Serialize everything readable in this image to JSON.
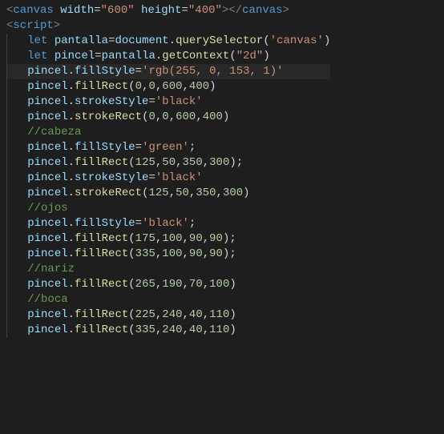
{
  "code": {
    "lines": [
      {
        "indent": 0,
        "type": "html",
        "tokens": [
          {
            "t": "tag-bracket",
            "v": "<"
          },
          {
            "t": "tag-name",
            "v": "canvas"
          },
          {
            "t": "pad",
            "v": " "
          },
          {
            "t": "attr-name",
            "v": "width"
          },
          {
            "t": "attr-equals",
            "v": "="
          },
          {
            "t": "attr-value",
            "v": "\"600\""
          },
          {
            "t": "pad",
            "v": " "
          },
          {
            "t": "attr-name",
            "v": "height"
          },
          {
            "t": "attr-equals",
            "v": "="
          },
          {
            "t": "attr-value",
            "v": "\"400\""
          },
          {
            "t": "tag-bracket",
            "v": "></"
          },
          {
            "t": "tag-name",
            "v": "canvas"
          },
          {
            "t": "tag-bracket",
            "v": ">"
          }
        ]
      },
      {
        "indent": 0,
        "type": "html",
        "tokens": [
          {
            "t": "tag-bracket",
            "v": "<"
          },
          {
            "t": "tag-name",
            "v": "script"
          },
          {
            "t": "tag-bracket",
            "v": ">"
          }
        ]
      },
      {
        "indent": 1,
        "type": "js",
        "tokens": [
          {
            "t": "keyword",
            "v": "let"
          },
          {
            "t": "pad",
            "v": " "
          },
          {
            "t": "variable",
            "v": "pantalla"
          },
          {
            "t": "operator",
            "v": "="
          },
          {
            "t": "identifier",
            "v": "document"
          },
          {
            "t": "punct",
            "v": "."
          },
          {
            "t": "method",
            "v": "querySelector"
          },
          {
            "t": "paren",
            "v": "("
          },
          {
            "t": "string",
            "v": "'canvas'"
          },
          {
            "t": "paren",
            "v": ")"
          }
        ]
      },
      {
        "indent": 1,
        "type": "js",
        "tokens": [
          {
            "t": "keyword",
            "v": "let"
          },
          {
            "t": "pad",
            "v": " "
          },
          {
            "t": "variable",
            "v": "pincel"
          },
          {
            "t": "operator",
            "v": "="
          },
          {
            "t": "identifier",
            "v": "pantalla"
          },
          {
            "t": "punct",
            "v": "."
          },
          {
            "t": "method",
            "v": "getContext"
          },
          {
            "t": "paren",
            "v": "("
          },
          {
            "t": "string",
            "v": "\"2d\""
          },
          {
            "t": "paren",
            "v": ")"
          }
        ]
      },
      {
        "indent": 1,
        "type": "js",
        "highlighted": true,
        "tokens": [
          {
            "t": "identifier",
            "v": "pincel"
          },
          {
            "t": "punct",
            "v": "."
          },
          {
            "t": "property",
            "v": "fillStyle"
          },
          {
            "t": "operator",
            "v": "="
          },
          {
            "t": "string",
            "v": "'rgb(255, 0, 153, 1)'"
          }
        ]
      },
      {
        "indent": 1,
        "type": "js",
        "tokens": [
          {
            "t": "identifier",
            "v": "pincel"
          },
          {
            "t": "punct",
            "v": "."
          },
          {
            "t": "method",
            "v": "fillRect"
          },
          {
            "t": "paren",
            "v": "("
          },
          {
            "t": "number",
            "v": "0"
          },
          {
            "t": "punct",
            "v": ","
          },
          {
            "t": "number",
            "v": "0"
          },
          {
            "t": "punct",
            "v": ","
          },
          {
            "t": "number",
            "v": "600"
          },
          {
            "t": "punct",
            "v": ","
          },
          {
            "t": "number",
            "v": "400"
          },
          {
            "t": "paren",
            "v": ")"
          }
        ]
      },
      {
        "indent": 1,
        "type": "js",
        "tokens": [
          {
            "t": "identifier",
            "v": "pincel"
          },
          {
            "t": "punct",
            "v": "."
          },
          {
            "t": "property",
            "v": "strokeStyle"
          },
          {
            "t": "operator",
            "v": "="
          },
          {
            "t": "string",
            "v": "'black'"
          }
        ]
      },
      {
        "indent": 1,
        "type": "js",
        "tokens": [
          {
            "t": "identifier",
            "v": "pincel"
          },
          {
            "t": "punct",
            "v": "."
          },
          {
            "t": "method",
            "v": "strokeRect"
          },
          {
            "t": "paren",
            "v": "("
          },
          {
            "t": "number",
            "v": "0"
          },
          {
            "t": "punct",
            "v": ","
          },
          {
            "t": "number",
            "v": "0"
          },
          {
            "t": "punct",
            "v": ","
          },
          {
            "t": "number",
            "v": "600"
          },
          {
            "t": "punct",
            "v": ","
          },
          {
            "t": "number",
            "v": "400"
          },
          {
            "t": "paren",
            "v": ")"
          }
        ]
      },
      {
        "indent": 1,
        "type": "js",
        "tokens": [
          {
            "t": "comment",
            "v": "//cabeza"
          }
        ]
      },
      {
        "indent": 1,
        "type": "js",
        "tokens": [
          {
            "t": "identifier",
            "v": "pincel"
          },
          {
            "t": "punct",
            "v": "."
          },
          {
            "t": "property",
            "v": "fillStyle"
          },
          {
            "t": "operator",
            "v": "="
          },
          {
            "t": "string",
            "v": "'green'"
          },
          {
            "t": "punct",
            "v": ";"
          }
        ]
      },
      {
        "indent": 1,
        "type": "js",
        "tokens": [
          {
            "t": "identifier",
            "v": "pincel"
          },
          {
            "t": "punct",
            "v": "."
          },
          {
            "t": "method",
            "v": "fillRect"
          },
          {
            "t": "paren",
            "v": "("
          },
          {
            "t": "number",
            "v": "125"
          },
          {
            "t": "punct",
            "v": ","
          },
          {
            "t": "number",
            "v": "50"
          },
          {
            "t": "punct",
            "v": ","
          },
          {
            "t": "number",
            "v": "350"
          },
          {
            "t": "punct",
            "v": ","
          },
          {
            "t": "number",
            "v": "300"
          },
          {
            "t": "paren",
            "v": ")"
          },
          {
            "t": "punct",
            "v": ";"
          }
        ]
      },
      {
        "indent": 1,
        "type": "js",
        "tokens": [
          {
            "t": "identifier",
            "v": "pincel"
          },
          {
            "t": "punct",
            "v": "."
          },
          {
            "t": "property",
            "v": "strokeStyle"
          },
          {
            "t": "operator",
            "v": "="
          },
          {
            "t": "string",
            "v": "'black'"
          }
        ]
      },
      {
        "indent": 1,
        "type": "js",
        "tokens": [
          {
            "t": "identifier",
            "v": "pincel"
          },
          {
            "t": "punct",
            "v": "."
          },
          {
            "t": "method",
            "v": "strokeRect"
          },
          {
            "t": "paren",
            "v": "("
          },
          {
            "t": "number",
            "v": "125"
          },
          {
            "t": "punct",
            "v": ","
          },
          {
            "t": "number",
            "v": "50"
          },
          {
            "t": "punct",
            "v": ","
          },
          {
            "t": "number",
            "v": "350"
          },
          {
            "t": "punct",
            "v": ","
          },
          {
            "t": "number",
            "v": "300"
          },
          {
            "t": "paren",
            "v": ")"
          }
        ]
      },
      {
        "indent": 1,
        "type": "js",
        "tokens": [
          {
            "t": "comment",
            "v": "//ojos"
          }
        ]
      },
      {
        "indent": 1,
        "type": "js",
        "tokens": [
          {
            "t": "identifier",
            "v": "pincel"
          },
          {
            "t": "punct",
            "v": "."
          },
          {
            "t": "property",
            "v": "fillStyle"
          },
          {
            "t": "operator",
            "v": "="
          },
          {
            "t": "string",
            "v": "'black'"
          },
          {
            "t": "punct",
            "v": ";"
          }
        ]
      },
      {
        "indent": 1,
        "type": "js",
        "tokens": [
          {
            "t": "identifier",
            "v": "pincel"
          },
          {
            "t": "punct",
            "v": "."
          },
          {
            "t": "method",
            "v": "fillRect"
          },
          {
            "t": "paren",
            "v": "("
          },
          {
            "t": "number",
            "v": "175"
          },
          {
            "t": "punct",
            "v": ","
          },
          {
            "t": "number",
            "v": "100"
          },
          {
            "t": "punct",
            "v": ","
          },
          {
            "t": "number",
            "v": "90"
          },
          {
            "t": "punct",
            "v": ","
          },
          {
            "t": "number",
            "v": "90"
          },
          {
            "t": "paren",
            "v": ")"
          },
          {
            "t": "punct",
            "v": ";"
          }
        ]
      },
      {
        "indent": 1,
        "type": "js",
        "tokens": [
          {
            "t": "identifier",
            "v": "pincel"
          },
          {
            "t": "punct",
            "v": "."
          },
          {
            "t": "method",
            "v": "fillRect"
          },
          {
            "t": "paren",
            "v": "("
          },
          {
            "t": "number",
            "v": "335"
          },
          {
            "t": "punct",
            "v": ","
          },
          {
            "t": "number",
            "v": "100"
          },
          {
            "t": "punct",
            "v": ","
          },
          {
            "t": "number",
            "v": "90"
          },
          {
            "t": "punct",
            "v": ","
          },
          {
            "t": "number",
            "v": "90"
          },
          {
            "t": "paren",
            "v": ")"
          },
          {
            "t": "punct",
            "v": ";"
          }
        ]
      },
      {
        "indent": 1,
        "type": "js",
        "tokens": [
          {
            "t": "comment",
            "v": "//nariz"
          }
        ]
      },
      {
        "indent": 1,
        "type": "js",
        "tokens": [
          {
            "t": "identifier",
            "v": "pincel"
          },
          {
            "t": "punct",
            "v": "."
          },
          {
            "t": "method",
            "v": "fillRect"
          },
          {
            "t": "paren",
            "v": "("
          },
          {
            "t": "number",
            "v": "265"
          },
          {
            "t": "punct",
            "v": ","
          },
          {
            "t": "number",
            "v": "190"
          },
          {
            "t": "punct",
            "v": ","
          },
          {
            "t": "number",
            "v": "70"
          },
          {
            "t": "punct",
            "v": ","
          },
          {
            "t": "number",
            "v": "100"
          },
          {
            "t": "paren",
            "v": ")"
          }
        ]
      },
      {
        "indent": 1,
        "type": "js",
        "tokens": [
          {
            "t": "comment",
            "v": "//boca"
          }
        ]
      },
      {
        "indent": 1,
        "type": "js",
        "tokens": [
          {
            "t": "identifier",
            "v": "pincel"
          },
          {
            "t": "punct",
            "v": "."
          },
          {
            "t": "method",
            "v": "fillRect"
          },
          {
            "t": "paren",
            "v": "("
          },
          {
            "t": "number",
            "v": "225"
          },
          {
            "t": "punct",
            "v": ","
          },
          {
            "t": "number",
            "v": "240"
          },
          {
            "t": "punct",
            "v": ","
          },
          {
            "t": "number",
            "v": "40"
          },
          {
            "t": "punct",
            "v": ","
          },
          {
            "t": "number",
            "v": "110"
          },
          {
            "t": "paren",
            "v": ")"
          }
        ]
      },
      {
        "indent": 1,
        "type": "js",
        "tokens": [
          {
            "t": "identifier",
            "v": "pincel"
          },
          {
            "t": "punct",
            "v": "."
          },
          {
            "t": "method",
            "v": "fillRect"
          },
          {
            "t": "paren",
            "v": "("
          },
          {
            "t": "number",
            "v": "335"
          },
          {
            "t": "punct",
            "v": ","
          },
          {
            "t": "number",
            "v": "240"
          },
          {
            "t": "punct",
            "v": ","
          },
          {
            "t": "number",
            "v": "40"
          },
          {
            "t": "punct",
            "v": ","
          },
          {
            "t": "number",
            "v": "110"
          },
          {
            "t": "paren",
            "v": ")"
          }
        ]
      }
    ]
  }
}
